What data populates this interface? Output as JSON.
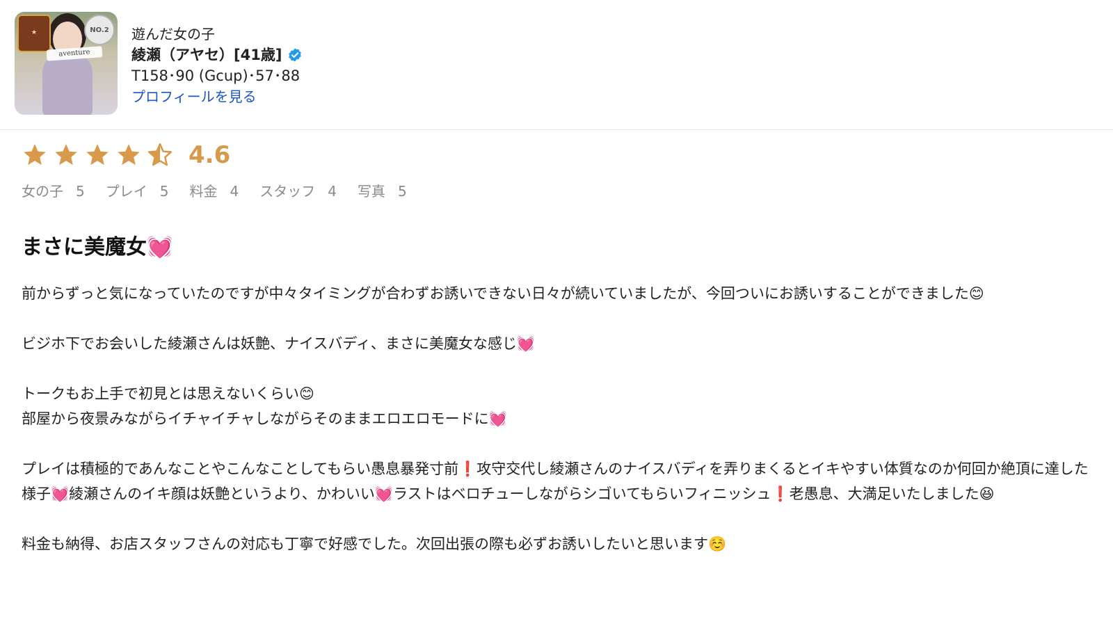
{
  "header": {
    "label": "遊んだ女の子",
    "name": "綾瀬（アヤセ）[41歳]",
    "verified_icon": "verified-check-icon",
    "verified_color": "#1d9bf0",
    "stats": "T158･90 (Gcup)･57･88",
    "profile_link": "プロフィールを見る",
    "avatar": {
      "ribbon_text": "aventure",
      "badge_right": "NO.2"
    }
  },
  "rating": {
    "stars": 4.5,
    "score": "4.6",
    "star_color": "#d89a4a"
  },
  "subratings": [
    {
      "label": "女の子",
      "value": "5"
    },
    {
      "label": "プレイ",
      "value": "5"
    },
    {
      "label": "料金",
      "value": "4"
    },
    {
      "label": "スタッフ",
      "value": "4"
    },
    {
      "label": "写真",
      "value": "5"
    }
  ],
  "review": {
    "title": "まさに美魔女💓",
    "paragraphs": [
      "前からずっと気になっていたのですが中々タイミングが合わずお誘いできない日々が続いていましたが、今回ついにお誘いすることができました😊",
      "ビジホ下でお会いした綾瀬さんは妖艶、ナイスバディ、まさに美魔女な感じ💓",
      "トークもお上手で初見とは思えないくらい😊\n部屋から夜景みながらイチャイチャしながらそのままエロエロモードに💓",
      "プレイは積極的であんなことやこんなことしてもらい愚息暴発寸前❗攻守交代し綾瀬さんのナイスバディを弄りまくるとイキやすい体質なのか何回か絶頂に達した様子💓綾瀬さんのイキ顔は妖艶というより、かわいい💓ラストはベロチューしながらシゴいてもらいフィニッシュ❗老愚息、大満足いたしました😆",
      "料金も納得、お店スタッフさんの対応も丁寧で好感でした。次回出張の際も必ずお誘いしたいと思います☺️"
    ]
  }
}
